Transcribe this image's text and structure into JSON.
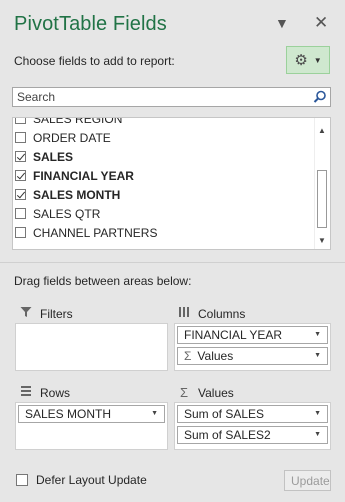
{
  "header": {
    "title": "PivotTable Fields"
  },
  "choose_label": "Choose fields to add to report:",
  "search": {
    "placeholder": "Search"
  },
  "fields": [
    {
      "label": "SALES REGION",
      "checked": false
    },
    {
      "label": "ORDER DATE",
      "checked": false
    },
    {
      "label": "SALES",
      "checked": true
    },
    {
      "label": "FINANCIAL YEAR",
      "checked": true
    },
    {
      "label": "SALES MONTH",
      "checked": true
    },
    {
      "label": "SALES QTR",
      "checked": false
    },
    {
      "label": "CHANNEL PARTNERS",
      "checked": false
    }
  ],
  "drag_label": "Drag fields between areas below:",
  "areas": {
    "filters": {
      "label": "Filters"
    },
    "columns": {
      "label": "Columns",
      "items": [
        "FINANCIAL YEAR",
        "Values"
      ]
    },
    "rows": {
      "label": "Rows",
      "items": [
        "SALES MONTH"
      ]
    },
    "values": {
      "label": "Values",
      "items": [
        "Sum of SALES",
        "Sum of SALES2"
      ]
    }
  },
  "sigma": "Σ",
  "defer_label": "Defer Layout Update",
  "update_label": "Update",
  "colors": {
    "accent": "#217346",
    "gear_bg": "#cfe8cf"
  }
}
